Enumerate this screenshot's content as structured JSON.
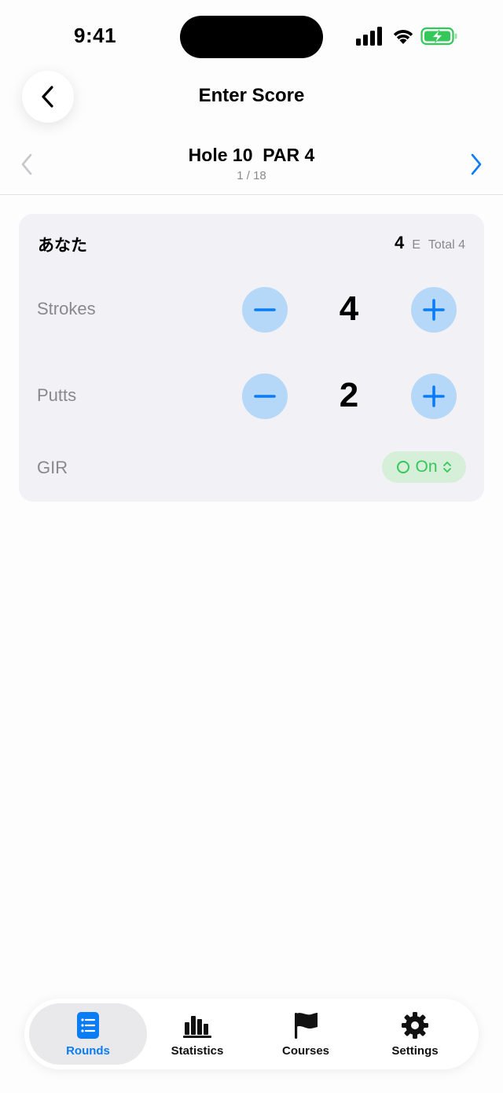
{
  "status_bar": {
    "time": "9:41"
  },
  "header": {
    "title": "Enter Score",
    "back_icon": "chevron-left-icon"
  },
  "hole_nav": {
    "title": "Hole 10  PAR 4",
    "progress": "1 / 18",
    "prev_icon": "chevron-left-icon",
    "next_icon": "chevron-right-icon"
  },
  "player": {
    "name": "あなた",
    "hole_score": "4",
    "to_par": "E",
    "total": "Total 4",
    "strokes": {
      "label": "Strokes",
      "value": "4"
    },
    "putts": {
      "label": "Putts",
      "value": "2"
    },
    "gir": {
      "label": "GIR",
      "value": "On",
      "icon": "circle-icon",
      "selector_icon": "chevron-up-down-icon"
    }
  },
  "tabs": [
    {
      "label": "Rounds",
      "icon": "list-icon",
      "active": true
    },
    {
      "label": "Statistics",
      "icon": "bar-chart-icon",
      "active": false
    },
    {
      "label": "Courses",
      "icon": "flag-icon",
      "active": false
    },
    {
      "label": "Settings",
      "icon": "gear-icon",
      "active": false
    }
  ],
  "colors": {
    "accent": "#0a7cf5",
    "stepper_bg": "#b6d8f8",
    "gir_green": "#34c759",
    "gir_bg": "#d5efd9",
    "card_bg": "#f1f1f6"
  }
}
